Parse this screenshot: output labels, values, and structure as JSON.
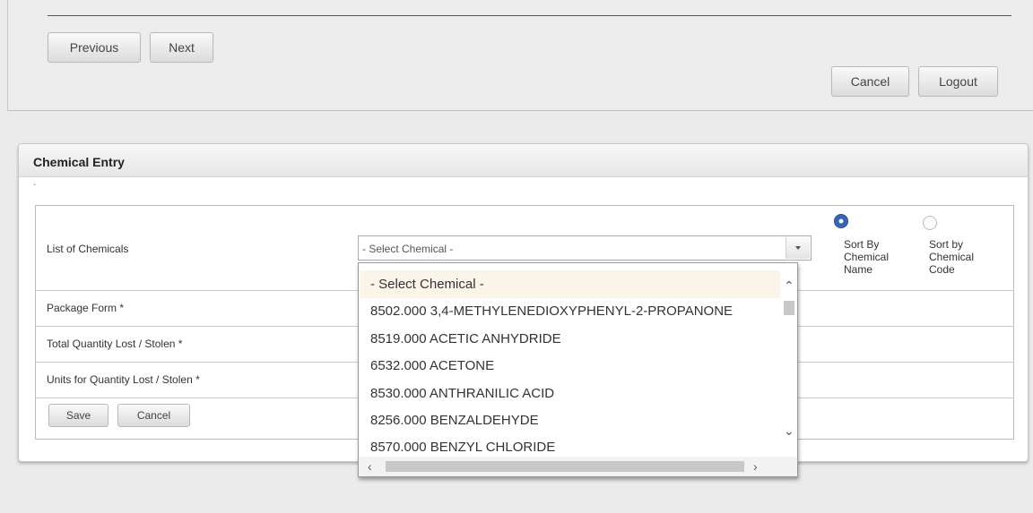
{
  "nav": {
    "previous_label": "Previous",
    "next_label": "Next",
    "cancel_label": "Cancel",
    "logout_label": "Logout"
  },
  "card": {
    "title": "Chemical Entry",
    "tick": "`"
  },
  "form": {
    "list_label": "List of Chemicals",
    "package_label": "Package Form *",
    "quantity_label": "Total Quantity Lost / Stolen *",
    "units_label": "Units for Quantity Lost / Stolen *",
    "select_value": "- Select Chemical -",
    "save_label": "Save",
    "cancel_label": "Cancel"
  },
  "sort": {
    "by_name_label": "Sort By Chemical Name",
    "by_name_checked": true,
    "by_code_label": "Sort by Chemical Code",
    "by_code_checked": false
  },
  "dropdown": {
    "options": [
      "- Select Chemical -",
      "8502.000 3,4-METHYLENEDIOXYPHENYL-2-PROPANONE",
      "8519.000 ACETIC ANHYDRIDE",
      "6532.000 ACETONE",
      "8530.000 ANTHRANILIC ACID",
      "8256.000 BENZALDEHYDE",
      "8570.000 BENZYL CHLORIDE"
    ],
    "highlighted_index": 0
  },
  "colors": {
    "accent_radio": "#3c6fc6",
    "highlight": "#faf5e8"
  }
}
